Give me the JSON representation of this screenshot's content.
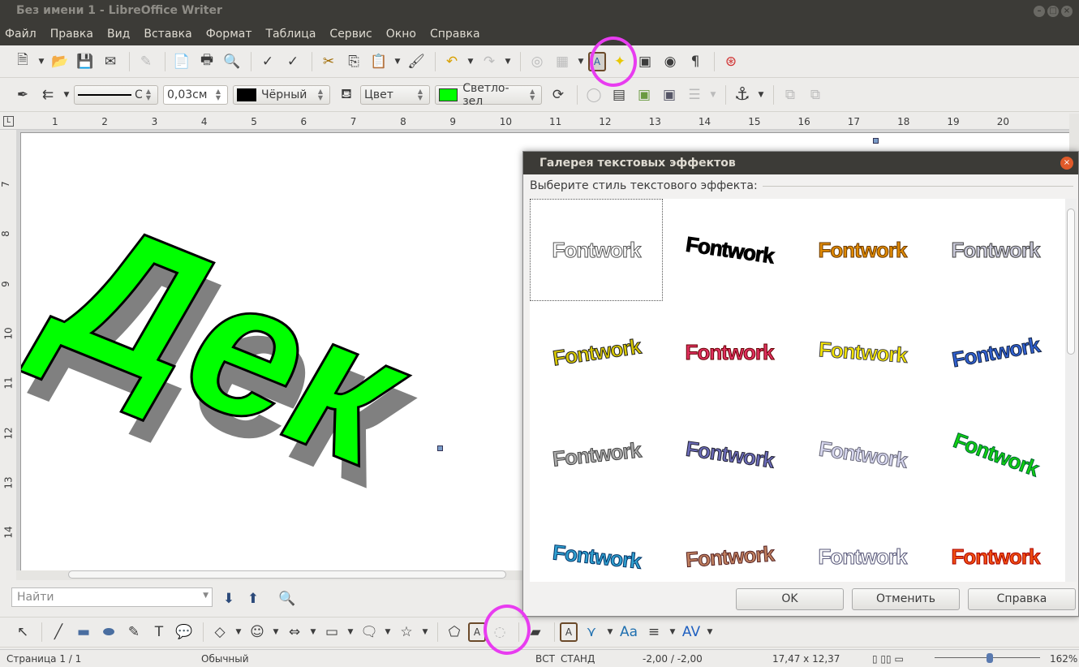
{
  "window": {
    "title": "Без имени 1 - LibreOffice Writer"
  },
  "menu": [
    "Файл",
    "Правка",
    "Вид",
    "Вставка",
    "Формат",
    "Таблица",
    "Сервис",
    "Окно",
    "Справка"
  ],
  "toolbar_standard": [
    "new-document-icon",
    "dd",
    "open-icon",
    "save-icon",
    "email-icon",
    "sep",
    "edit-mode-icon",
    "sep",
    "export-pdf-icon",
    "print-icon",
    "print-preview-icon",
    "sep",
    "spellcheck-icon",
    "autospellcheck-icon",
    "sep",
    "cut-icon",
    "copy-icon",
    "paste-icon",
    "dd",
    "clone-format-icon",
    "sep",
    "undo-icon",
    "dd",
    "redo-icon",
    "dd",
    "sep",
    "hyperlink-icon",
    "table-icon",
    "dd",
    "fontwork-gallery-icon",
    "star-icon",
    "gallery-icon",
    "navigator-icon",
    "pilcrow-icon",
    "sep",
    "help-icon"
  ],
  "toolbar_frame": {
    "line_style": "С",
    "line_width": "0,03см",
    "line_color": "Чёрный",
    "area_style": "Цвет",
    "area_color": "Светло-зел",
    "line_color_hex": "#000000",
    "area_color_hex": "#00ff00"
  },
  "ruler": [
    "1",
    "2",
    "3",
    "4",
    "5",
    "6",
    "7",
    "8",
    "9",
    "10",
    "11",
    "12",
    "13",
    "14",
    "15",
    "16",
    "17",
    "18",
    "19",
    "20"
  ],
  "vruler": [
    "7",
    "8",
    "9",
    "10",
    "11",
    "12",
    "13",
    "14"
  ],
  "document": {
    "fontwork_text": "Дек",
    "fill": "#00ff00",
    "shadow": "#808080"
  },
  "dialog": {
    "title": "Галерея текстовых эффектов",
    "label": "Выберите стиль текстового эффекта:",
    "ok": "OK",
    "cancel": "Отменить",
    "help": "Справка",
    "items": [
      {
        "text": "Fontwork",
        "color": "#fff",
        "stroke": "#555"
      },
      {
        "text": "Fontwork",
        "color": "#000",
        "stroke": "#000"
      },
      {
        "text": "Fontwork",
        "color": "#e08a00",
        "stroke": "#6b3a00"
      },
      {
        "text": "Fontwork",
        "color": "#c9c9d9",
        "stroke": "#444"
      },
      {
        "text": "Fontwork",
        "color": "#d8c800",
        "stroke": "#222"
      },
      {
        "text": "Fontwork",
        "color": "#e03060",
        "stroke": "#600"
      },
      {
        "text": "Fontwork",
        "color": "#f4e400",
        "stroke": "#444"
      },
      {
        "text": "Fontwork",
        "color": "#3060d0",
        "stroke": "#124"
      },
      {
        "text": "Fontwork",
        "color": "#aaa",
        "stroke": "#444"
      },
      {
        "text": "Fontwork",
        "color": "#6b6bb8",
        "stroke": "#223"
      },
      {
        "text": "Fontwork",
        "color": "#d8d8f0",
        "stroke": "#667"
      },
      {
        "text": "Fontwork",
        "color": "#10d010",
        "stroke": "#063"
      },
      {
        "text": "Fontwork",
        "color": "#30a0d0",
        "stroke": "#036"
      },
      {
        "text": "Fontwork",
        "color": "#c08060",
        "stroke": "#522"
      },
      {
        "text": "Fontwork",
        "color": "#fff",
        "stroke": "#557"
      },
      {
        "text": "Fontwork",
        "color": "#f05010",
        "stroke": "#a00"
      }
    ]
  },
  "find": {
    "placeholder": "Найти"
  },
  "toolbar_drawing": [
    "select-icon",
    "sep",
    "line-icon",
    "rectangle-icon",
    "ellipse-icon",
    "freeform-icon",
    "text-icon",
    "callout-icon",
    "sep",
    "basic-shapes-icon",
    "dd",
    "symbol-shapes-icon",
    "dd",
    "block-arrows-icon",
    "dd",
    "flowchart-icon",
    "dd",
    "callouts-icon",
    "dd",
    "stars-icon",
    "dd",
    "sep",
    "points-icon",
    "fontwork-icon",
    "extrusion-icon",
    "sep",
    "from-file-icon",
    "sep",
    "fontwork-gallery-icon",
    "fontwork-shape-icon",
    "dd",
    "fontwork-same-height-icon",
    "fontwork-align-icon",
    "dd",
    "fontwork-spacing-icon",
    "dd"
  ],
  "status": {
    "page": "Страница 1 / 1",
    "style": "Обычный",
    "insert": "ВСТ",
    "select": "СТАНД",
    "position": "-2,00 / -2,00",
    "size": "17,47 x 12,37",
    "zoom": "162%",
    "zoom_level": 162
  }
}
